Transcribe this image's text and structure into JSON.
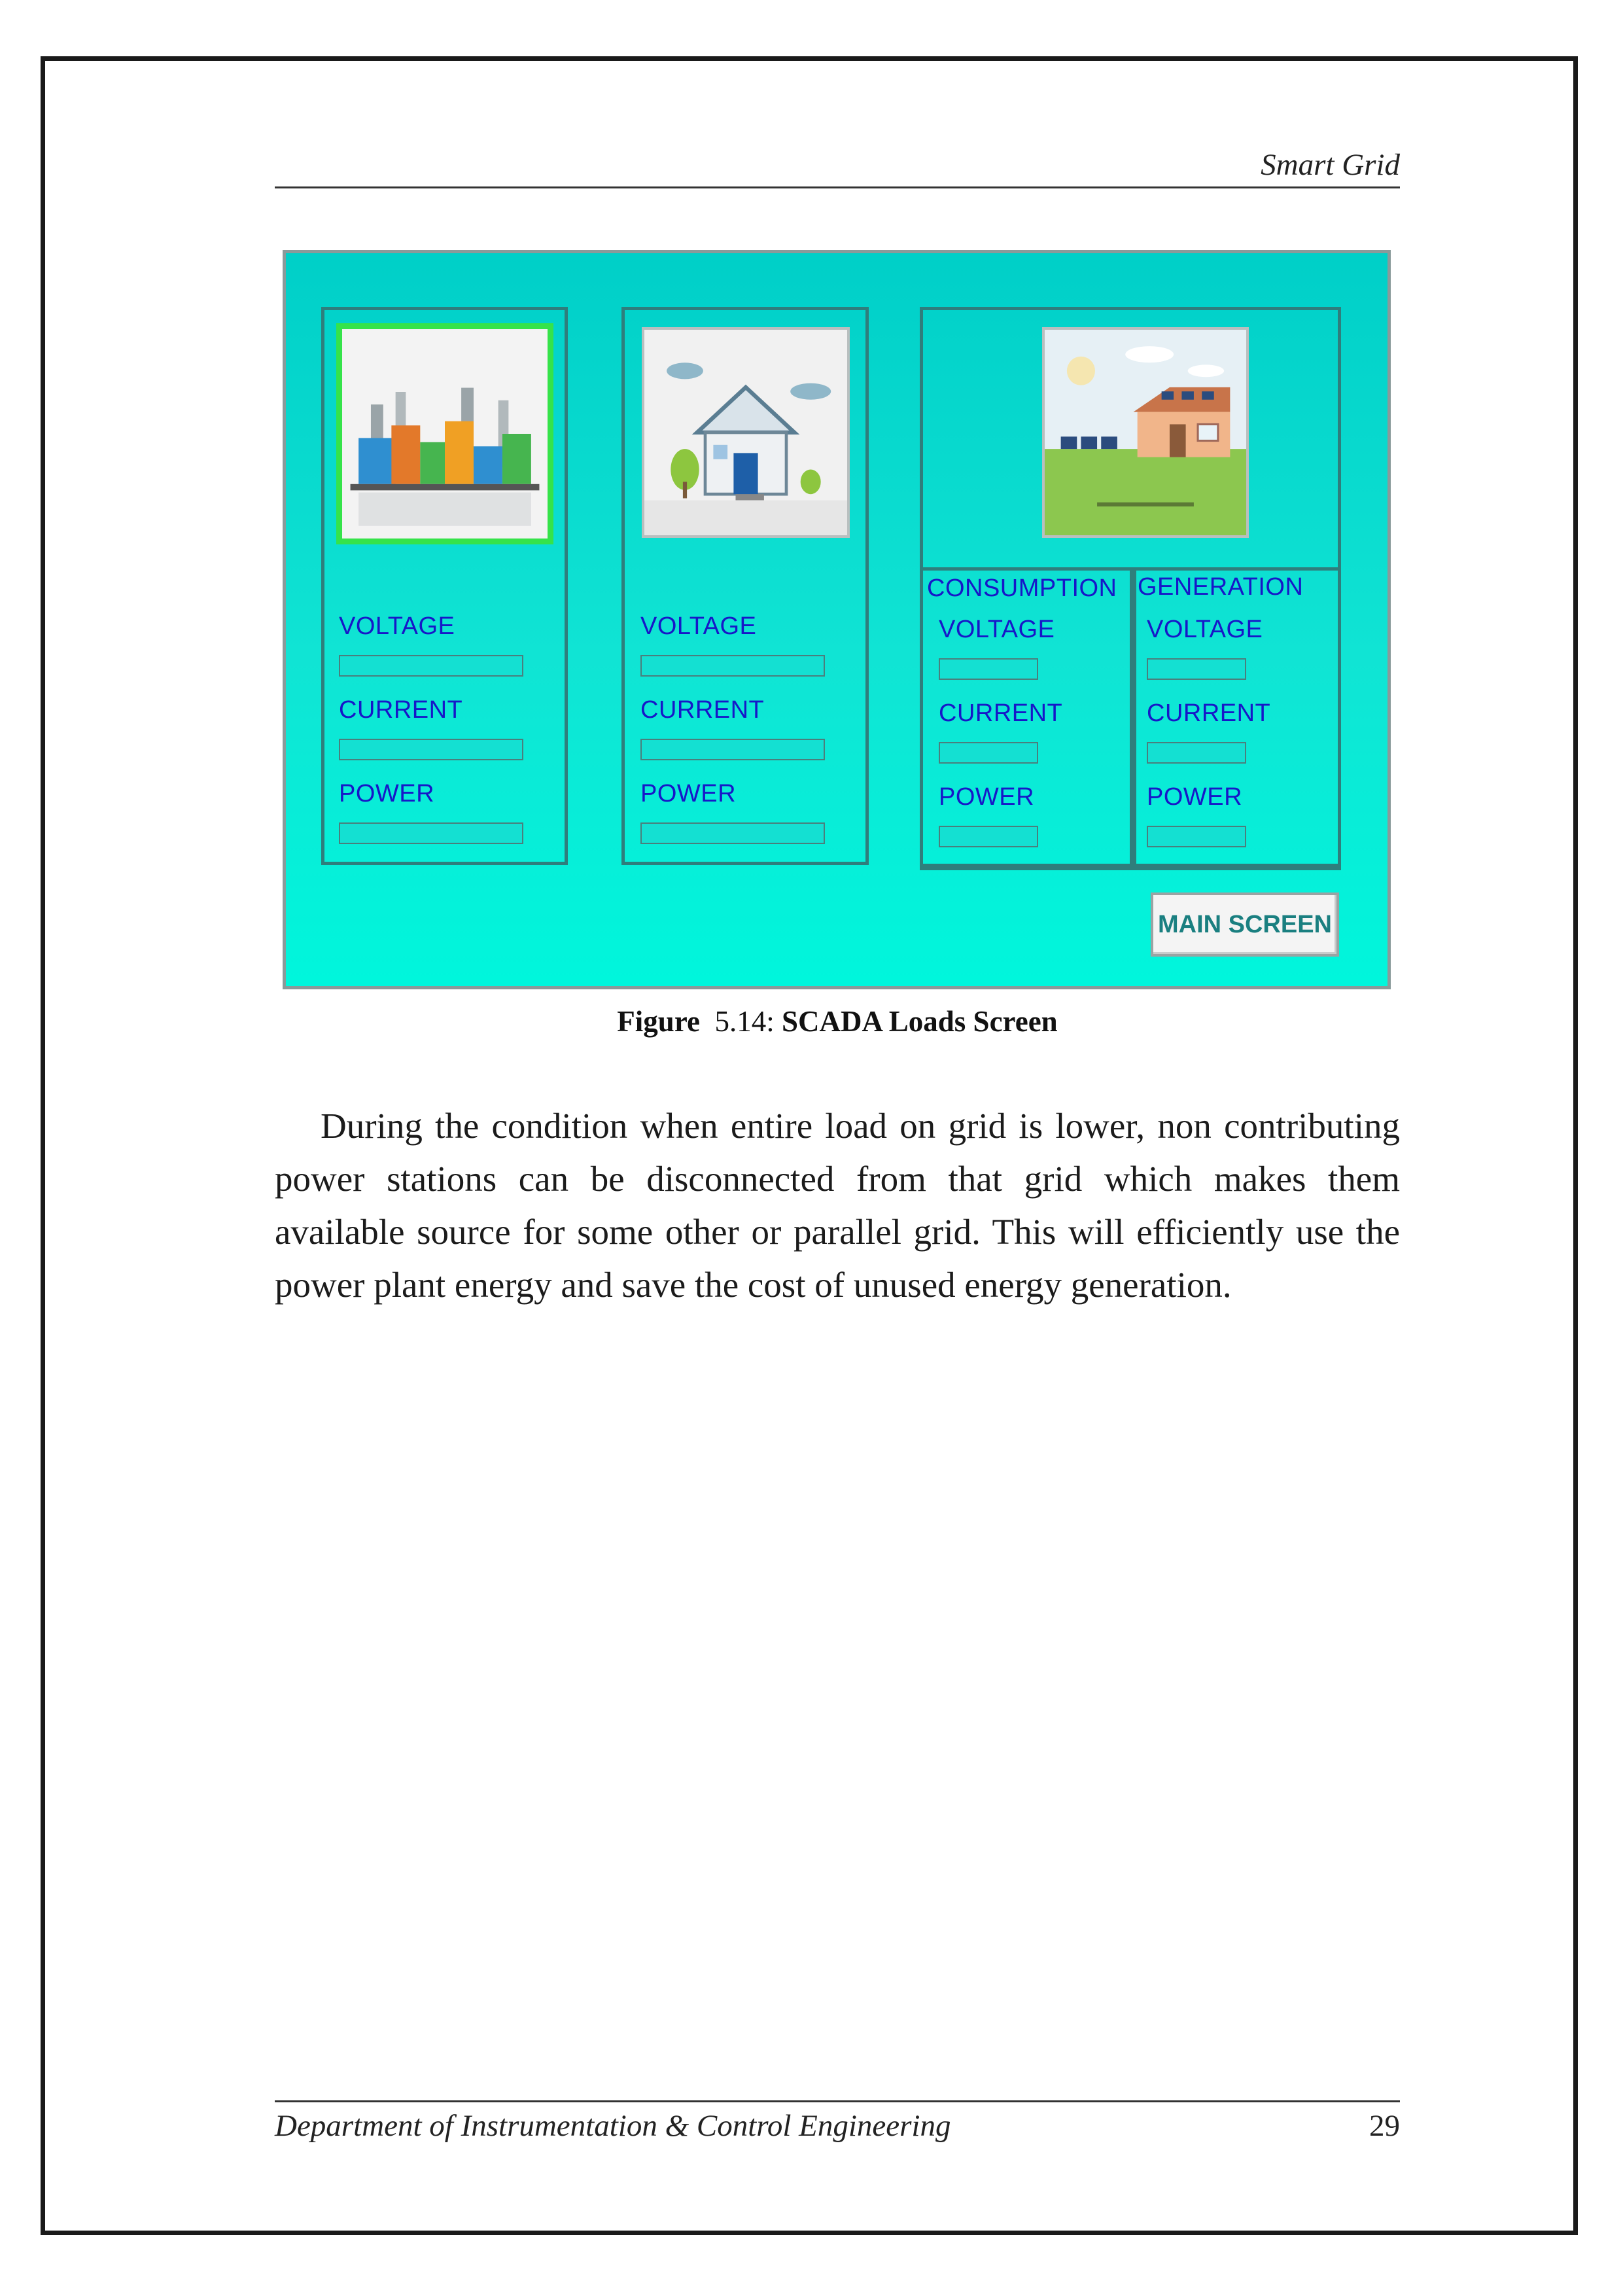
{
  "header": {
    "running_title": "Smart Grid"
  },
  "scada": {
    "panels": [
      {
        "id": "industrial",
        "image": "industrial-plant-icon",
        "fields": [
          {
            "label": "VOLTAGE",
            "value": ""
          },
          {
            "label": "CURRENT",
            "value": ""
          },
          {
            "label": "POWER",
            "value": ""
          }
        ]
      },
      {
        "id": "residential",
        "image": "house-icon",
        "fields": [
          {
            "label": "VOLTAGE",
            "value": ""
          },
          {
            "label": "CURRENT",
            "value": ""
          },
          {
            "label": "POWER",
            "value": ""
          }
        ]
      },
      {
        "id": "solar-home",
        "image": "solar-house-icon",
        "consumption": {
          "title": "CONSUMPTION",
          "fields": [
            {
              "label": "VOLTAGE",
              "value": ""
            },
            {
              "label": "CURRENT",
              "value": ""
            },
            {
              "label": "POWER",
              "value": ""
            }
          ]
        },
        "generation": {
          "title": "GENERATION",
          "fields": [
            {
              "label": "VOLTAGE",
              "value": ""
            },
            {
              "label": "CURRENT",
              "value": ""
            },
            {
              "label": "POWER",
              "value": ""
            }
          ]
        }
      }
    ],
    "main_screen_label": "MAIN SCREEN",
    "colors": {
      "background": "#00e0d0",
      "label": "#1717c8",
      "panel_border": "#2f7e7c",
      "selected_border": "#35e34a",
      "button_text": "#1a7f80"
    }
  },
  "figure": {
    "label": "Figure",
    "number": "5.14:",
    "title": "SCADA Loads Screen"
  },
  "body": {
    "paragraph": "During the condition when entire load on grid is lower, non contributing power stations can be disconnected from that grid which makes them available source for some other or parallel grid. This will efficiently use the power plant energy and save the cost of unused energy generation."
  },
  "footer": {
    "department": "Department of Instrumentation & Control Engineering",
    "page_number": "29"
  }
}
